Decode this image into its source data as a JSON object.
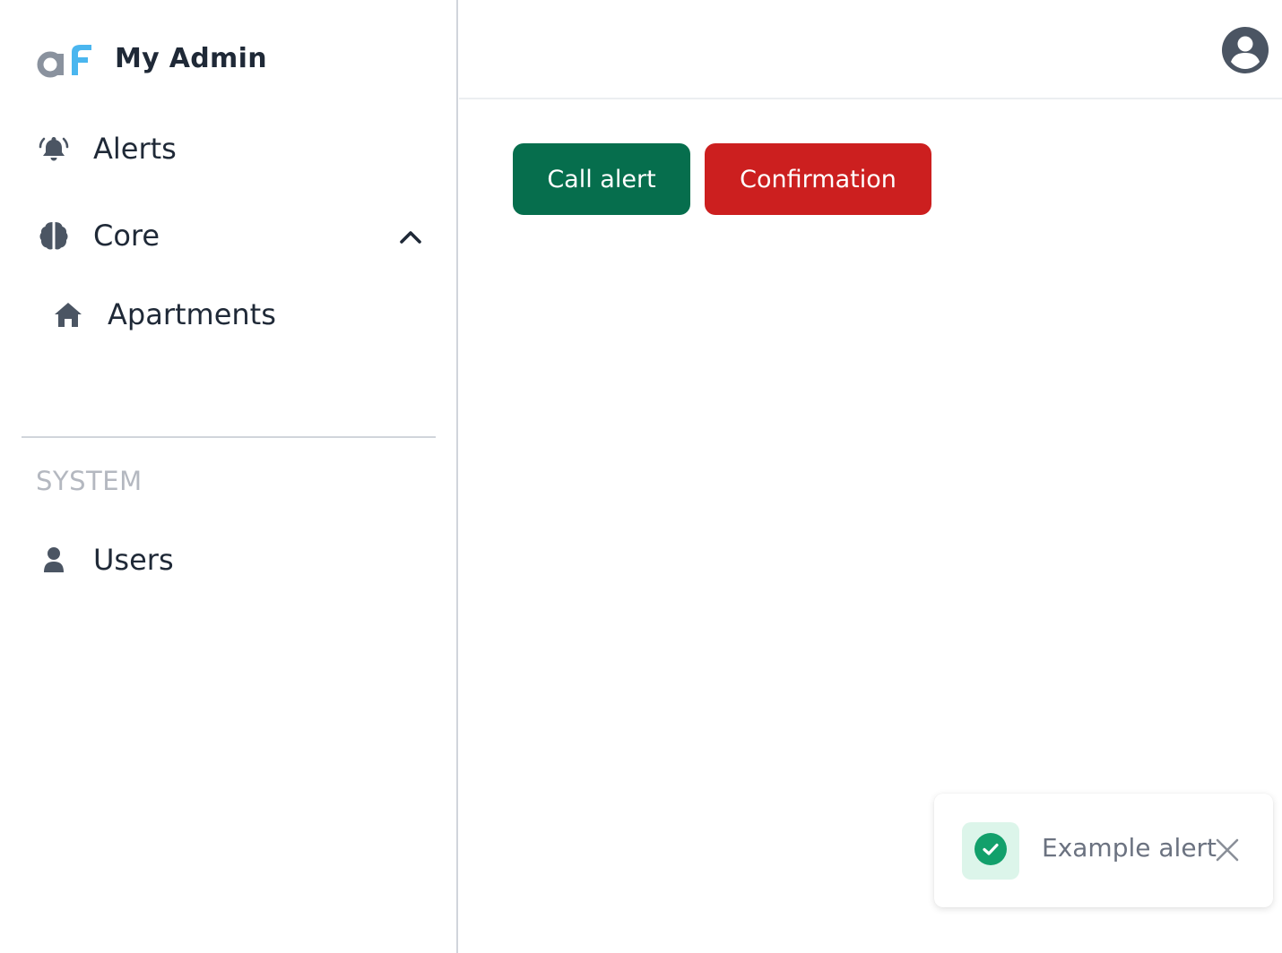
{
  "app": {
    "brand_name": "My Admin",
    "brand_colors": {
      "gray": "#8a929e",
      "blue": "#4ab6ef"
    }
  },
  "sidebar": {
    "items": [
      {
        "label": "Alerts",
        "icon": "bell-icon"
      },
      {
        "label": "Core",
        "icon": "brain-icon",
        "expanded": true
      },
      {
        "label": "Apartments",
        "icon": "home-icon"
      }
    ],
    "section_title": "SYSTEM",
    "system_items": [
      {
        "label": "Users",
        "icon": "user-icon"
      }
    ]
  },
  "header": {
    "avatar_icon": "user-circle-icon"
  },
  "main": {
    "call_alert_label": "Call alert",
    "confirmation_label": "Confirmation",
    "colors": {
      "success": "#066e4d",
      "danger": "#cc1f1f"
    }
  },
  "toast": {
    "text": "Example alert",
    "icon": "check-circle-icon",
    "color": "#12a06b"
  }
}
